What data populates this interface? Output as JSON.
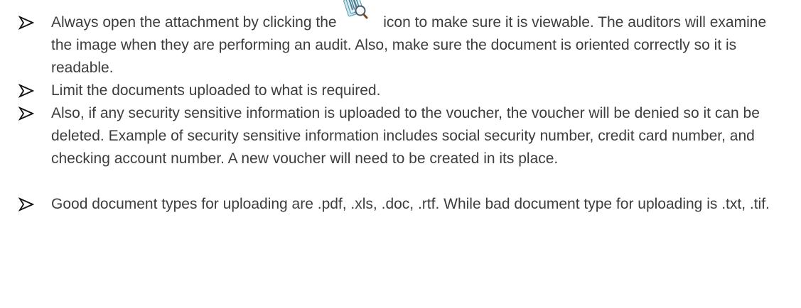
{
  "bullets": [
    {
      "before_icon": "Always open the attachment by clicking the",
      "icon": "view-attachment-icon",
      "after_icon": "icon to make sure it is viewable. The",
      "continuation": "auditors will examine the image when they are performing an audit. Also, make sure the document is oriented correctly so it is readable."
    },
    {
      "text": "Limit the documents uploaded to what is required."
    },
    {
      "text": "Also, if any security sensitive information is uploaded to the voucher, the voucher will be denied so it can be deleted. Example of security sensitive information includes social security number, credit card number, and checking account number. A new voucher will need to be created in its place."
    },
    {
      "text": "Good document types for uploading are .pdf, .xls, .doc, .rtf. While bad document type for uploading is .txt, .tif."
    }
  ],
  "bullet_glyph": "arrowhead-bullet-icon",
  "text_color": "#3d3d3d"
}
